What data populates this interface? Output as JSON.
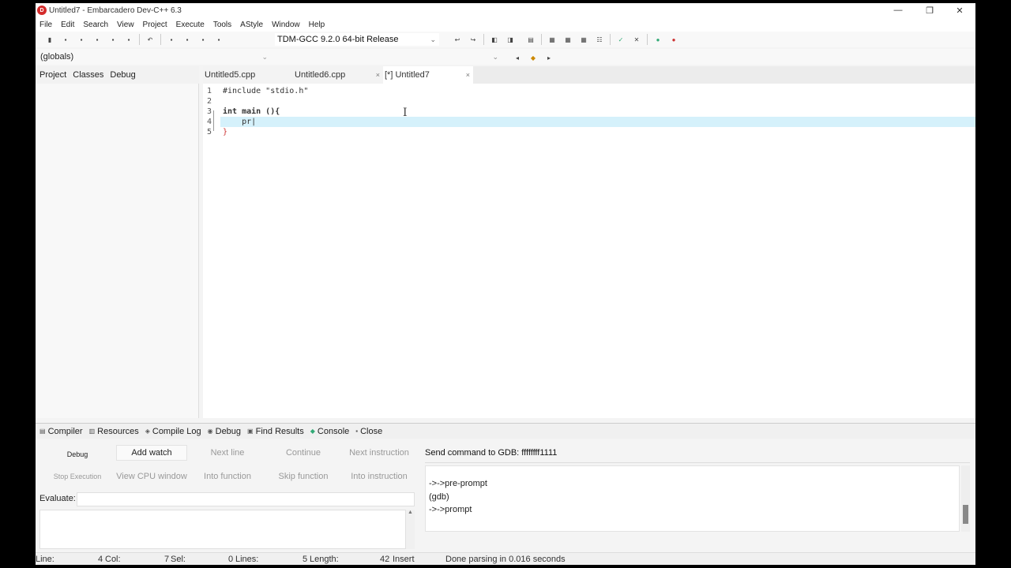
{
  "window": {
    "title": "Untitled7 - Embarcadero Dev-C++ 6.3",
    "icon_letter": "D",
    "controls": [
      "—",
      "❐",
      "✕"
    ]
  },
  "menu": [
    "File",
    "Edit",
    "Search",
    "View",
    "Project",
    "Execute",
    "Tools",
    "AStyle",
    "Window",
    "Help"
  ],
  "toolbar": {
    "compiler": "TDM-GCC 9.2.0 64-bit Release",
    "scope": "(globals)"
  },
  "left_panel": {
    "tabs": [
      "Project",
      "Classes",
      "Debug"
    ]
  },
  "editor": {
    "tabs": [
      {
        "label": "Untitled5.cpp",
        "close": ""
      },
      {
        "label": "Untitled6.cpp",
        "close": "×"
      },
      {
        "label": "[*] Untitled7",
        "close": "×"
      }
    ],
    "line_numbers": [
      "1",
      "2",
      "3",
      "4",
      "5"
    ],
    "lines": [
      "#include \"stdio.h\"",
      "",
      "int main (){",
      "    pr|",
      "}"
    ]
  },
  "bottom_tabs": [
    "Compiler",
    "Resources",
    "Compile Log",
    "Debug",
    "Find Results",
    "Console",
    "Close"
  ],
  "debug": {
    "buttons_row1": [
      "Debug",
      "Add watch",
      "Next line",
      "Continue",
      "Next instruction"
    ],
    "buttons_row2": [
      "Stop Execution",
      "View CPU window",
      "Into function",
      "Skip function",
      "Into instruction"
    ],
    "evaluate_label": "Evaluate:",
    "gdb_label": "Send command to GDB: ffffffff1111",
    "gdb_output": [
      "->->pre-prompt",
      "(gdb)",
      "->->prompt"
    ]
  },
  "status": {
    "line_label": "Line:",
    "line": "4",
    "col_label": "Col:",
    "col": "7",
    "sel_label": "Sel:",
    "sel": "0",
    "lines_label": "Lines:",
    "lines": "5",
    "length_label": "Length:",
    "length": "42",
    "mode": "Insert",
    "message": "Done parsing in 0.016 seconds"
  }
}
